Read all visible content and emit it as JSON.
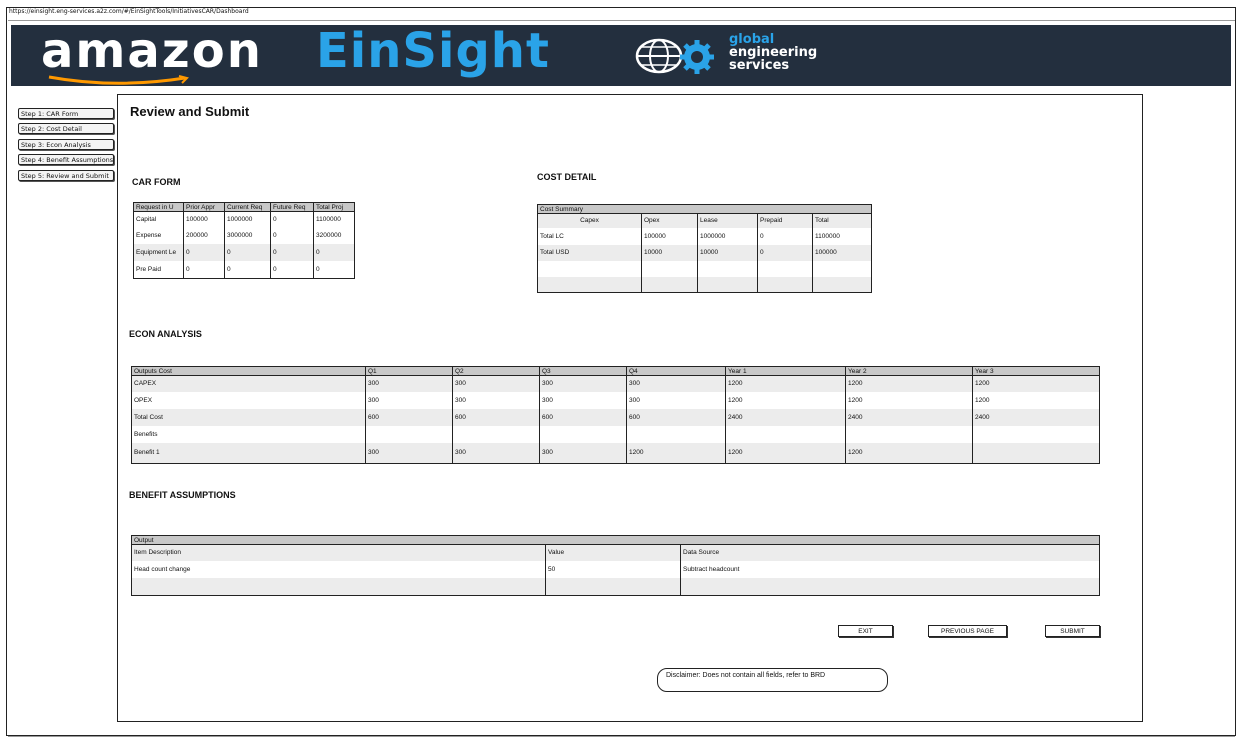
{
  "url": "https://einsight.eng-services.a2z.com/#/EinSightTools/InitiativesCAR/Dashboard",
  "brand": {
    "amazon": "amazon",
    "einsight": "EinSight",
    "ges": [
      "global",
      "engineering",
      "services"
    ],
    "accent_color": "#2aa3e8",
    "banner_color": "#232f3e"
  },
  "steps": [
    "Step 1: CAR Form",
    "Step 2: Cost Detail",
    "Step 3: Econ Analysis",
    "Step 4: Benefit Assumptions",
    "Step 5: Review and Submit"
  ],
  "page_title": "Review and Submit",
  "car_form": {
    "heading": "CAR FORM",
    "headers": [
      "Request in U",
      "Prior Appr",
      "Current Req",
      "Future Req",
      "Total Proj"
    ],
    "rows": [
      [
        "Capital",
        "100000",
        "1000000",
        "0",
        "1100000"
      ],
      [
        "Expense",
        "200000",
        "3000000",
        "0",
        "3200000"
      ],
      [
        "Equipment Le",
        "0",
        "0",
        "0",
        "0"
      ],
      [
        "Pre Paid",
        "0",
        "0",
        "0",
        "0"
      ]
    ]
  },
  "cost_detail": {
    "heading": "COST DETAIL",
    "caption": "Cost Summary",
    "headers": [
      "Capex",
      "Opex",
      "Lease",
      "Prepaid",
      "Total"
    ],
    "rows": [
      [
        "Total LC",
        "100000",
        "1000000",
        "0",
        "1100000"
      ],
      [
        "Total USD",
        "10000",
        "10000",
        "0",
        "100000"
      ],
      [
        "",
        "",
        "",
        "",
        ""
      ],
      [
        "",
        "",
        "",
        "",
        ""
      ]
    ]
  },
  "econ_analysis": {
    "heading": "ECON ANALYSIS",
    "headers": [
      "Outputs Cost",
      "Q1",
      "Q2",
      "Q3",
      "Q4",
      "Year 1",
      "Year 2",
      "Year 3"
    ],
    "rows": [
      [
        "CAPEX",
        "300",
        "300",
        "300",
        "300",
        "1200",
        "1200",
        "1200"
      ],
      [
        "OPEX",
        "300",
        "300",
        "300",
        "300",
        "1200",
        "1200",
        "1200"
      ],
      [
        "Total Cost",
        "600",
        "600",
        "600",
        "600",
        "2400",
        "2400",
        "2400"
      ],
      [
        "Benefits",
        "",
        "",
        "",
        "",
        "",
        "",
        ""
      ],
      [
        "Benefit 1",
        "300",
        "300",
        "300",
        "1200",
        "1200",
        "1200",
        ""
      ]
    ]
  },
  "benefit_assumptions": {
    "heading": "BENEFIT ASSUMPTIONS",
    "caption": "Output",
    "headers": [
      "Item Description",
      "Value",
      "Data Source"
    ],
    "rows": [
      [
        "Head count change",
        "50",
        "Subtract headcount"
      ],
      [
        "",
        "",
        ""
      ]
    ]
  },
  "buttons": {
    "exit": "EXIT",
    "previous": "PREVIOUS PAGE",
    "submit": "SUBMIT"
  },
  "disclaimer": "Disclaimer: Does not contain all fields, refer to BRD"
}
